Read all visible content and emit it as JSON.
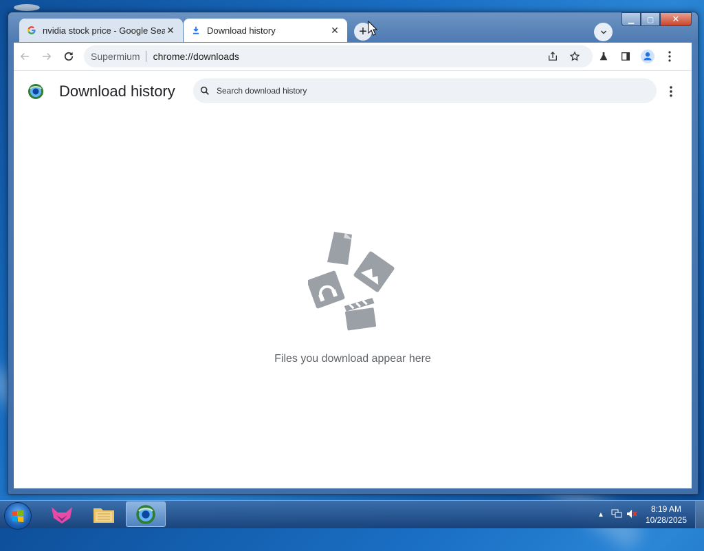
{
  "browser": {
    "tabs": [
      {
        "title": "nvidia stock price - Google Search",
        "favicon": "google-g-icon",
        "active": false
      },
      {
        "title": "Download history",
        "favicon": "download-icon",
        "active": true
      }
    ],
    "new_tab_label": "+",
    "address": {
      "site_chip": "Supermium",
      "url": "chrome://downloads"
    }
  },
  "page": {
    "title": "Download history",
    "search_placeholder": "Search download history",
    "empty_message": "Files you download appear here"
  },
  "taskbar": {
    "clock_time": "8:19 AM",
    "clock_date": "10/28/2025"
  },
  "colors": {
    "accent": "#1a73e8",
    "empty_art": "#9aa0a6"
  }
}
